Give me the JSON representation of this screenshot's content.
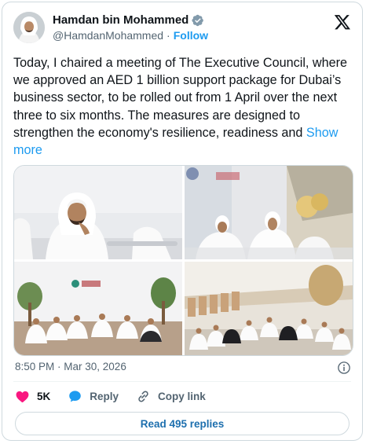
{
  "author": {
    "name": "Hamdan bin Mohammed",
    "handle": "@HamdanMohammed",
    "separator": "·",
    "follow_label": "Follow",
    "verified_color": "#829aab"
  },
  "post": {
    "text": "Today, I chaired a meeting of The Executive Council, where we approved an AED 1 billion support package for Dubai’s business sector, to be rolled out from 1 April over the next three to six months. The measures are designed to strengthen the economy's resilience, readiness and ",
    "show_more_label": "Show more",
    "timestamp": "8:50 PM · Mar 30, 2026"
  },
  "media": {
    "photos": [
      {
        "name": "meeting-photo-1",
        "subject": "man in white ghutra seated at meeting"
      },
      {
        "name": "meeting-photo-2",
        "subject": "council members seated in bright hall"
      },
      {
        "name": "meeting-photo-3",
        "subject": "council seated in semicircle before logo wall"
      },
      {
        "name": "meeting-photo-4",
        "subject": "wide view of council meeting"
      }
    ]
  },
  "actions": {
    "like_count": "5K",
    "reply_label": "Reply",
    "copy_link_label": "Copy link",
    "read_replies_label": "Read 495 replies"
  },
  "colors": {
    "accent": "#1d9bf0",
    "like": "#f91880",
    "text_secondary": "#536471"
  },
  "icons": [
    "verified-badge-icon",
    "x-logo-icon",
    "info-icon",
    "heart-icon",
    "reply-bubble-icon",
    "link-icon"
  ]
}
